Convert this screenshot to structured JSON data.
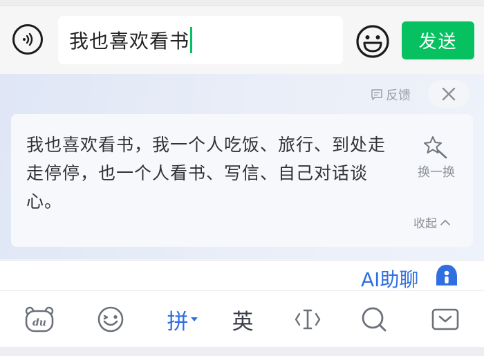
{
  "input_bar": {
    "text_value": "我也喜欢看书",
    "send_label": "发送"
  },
  "suggestion": {
    "feedback_label": "反馈",
    "text": "我也喜欢看书，我一个人吃饭、旅行、到处走走停停，也一个人看书、写信、自己对话谈心。",
    "swap_label": "换一换",
    "collapse_label": "收起"
  },
  "ai_row": {
    "label": "AI助聊"
  },
  "toolbar": {
    "pinyin_label": "拼",
    "english_label": "英"
  },
  "colors": {
    "accent_green": "#07c160",
    "accent_blue": "#2f6fe0"
  }
}
